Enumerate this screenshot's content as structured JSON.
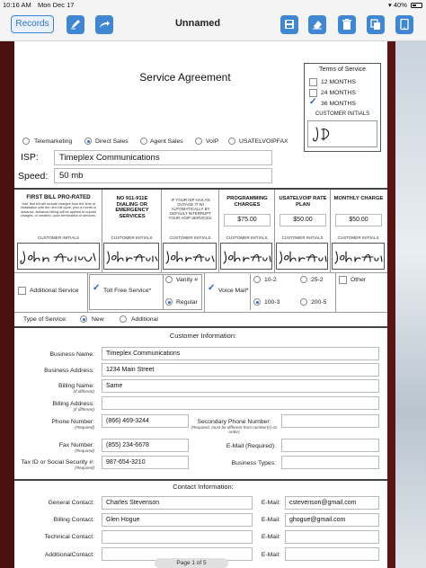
{
  "status_bar": {
    "time": "10:16 AM",
    "date": "Mon Dec 17",
    "battery": "40%"
  },
  "toolbar": {
    "records_label": "Records",
    "title": "Unnamed",
    "icons": [
      "pencil-icon",
      "share-icon",
      "save-icon",
      "eraser-icon",
      "trash-icon",
      "duplicate-icon",
      "tablet-icon"
    ]
  },
  "form": {
    "title": "Service Agreement",
    "term": {
      "label": "Terms of Service",
      "options": [
        "12 MONTHS",
        "24 MONTHS",
        "36 MONTHS"
      ],
      "selected": "36 MONTHS",
      "customer_initials_label": "CUSTOMER INITIALS"
    },
    "sales_types": [
      "Telemarketing",
      "Direct Sales",
      "Agent Sales",
      "VoIP",
      "USATELVOIPFAX"
    ],
    "sales_selected": "Direct Sales",
    "isp": {
      "label": "ISP:",
      "value": "Timeplex Communications"
    },
    "speed": {
      "label": "Speed:",
      "value": "50 mb"
    },
    "columns": [
      {
        "title": "FIRST BILL PRO-RATED",
        "text": "Your first bill will include charges from the time of installation until the next bill cycle, plus a month in advance. Advance billing will be applied to unpaid charges, or credited, upon termination of services.",
        "initials": "CUSTOMER INITIALS"
      },
      {
        "title": "NO 911-911E DIALING OR EMERGENCY SERVICES",
        "text": "",
        "initials": "CUSTOMER INITIALS"
      },
      {
        "title": "",
        "text": "IF YOUR ISP HAS AN OUTAGE IT WI AUTOMATICALLY BY DEFAULT INTERRUPT YOUR VOIP SERVICES.",
        "initials": "CUSTOMER INITIALS"
      },
      {
        "title": "PROGRAMMING CHARGES",
        "amount": "$75.00",
        "initials": "CUSTOMER INITIALS"
      },
      {
        "title": "USATELVOIP RATE PLAN",
        "amount": "$50.00",
        "initials": "CUSTOMER INITIALS"
      },
      {
        "title": "MONTHLY CHARGE",
        "amount": "$50.00",
        "initials": "CUSTOMER INITIALS"
      }
    ],
    "services": {
      "additional_service": "Additional Service",
      "toll_free": "Toll Free Service*",
      "vanity": "Vanity #",
      "regular": "Regular",
      "voice_mail": "Voice Mail*",
      "vm_options": [
        "10-2",
        "25-2",
        "100-3",
        "200-5"
      ],
      "vm_selected": "100-3",
      "other": "Other"
    },
    "type_of_service": {
      "label": "Type of Service:",
      "options": [
        "New",
        "Additional"
      ],
      "selected": "New"
    },
    "customer_info": {
      "title": "Customer Information:",
      "business_name": {
        "label": "Business Name:",
        "value": "Timeplex Communications"
      },
      "business_address": {
        "label": "Business Address:",
        "value": "1234 Main Street"
      },
      "billing_name": {
        "label": "Billing Name:",
        "note": "(If different)",
        "value": "Same"
      },
      "billing_address": {
        "label": "Billing Address:",
        "note": "(If different)",
        "value": ""
      },
      "phone": {
        "label": "Phone Number:",
        "note": "(Required)",
        "value": "(866) 469-3244"
      },
      "secondary_phone": {
        "label": "Secondary Phone Number:",
        "note": "(Required, must be different from number(s) on order)",
        "value": ""
      },
      "fax": {
        "label": "Fax Number:",
        "note": "(Required)",
        "value": "(855) 234-6678"
      },
      "email": {
        "label": "E-Mail (Required):",
        "value": ""
      },
      "tax_id": {
        "label": "Tax ID or Social Security #:",
        "note": "(Required)",
        "value": "987-654-3210"
      },
      "business_types": {
        "label": "Business Types:",
        "value": ""
      }
    },
    "contact_info": {
      "title": "Contact Information:",
      "general": {
        "label": "General Contact:",
        "value": "Charles Stevenson",
        "email_label": "E-Mail:",
        "email": "cstevenson@gmail.com"
      },
      "billing": {
        "label": "Billing Contact:",
        "value": "Glen Hogue",
        "email_label": "E-Mail:",
        "email": "ghogue@gmail.com"
      },
      "technical": {
        "label": "Technical Contact:",
        "value": "",
        "email_label": "E-Mail:",
        "email": ""
      },
      "additional": {
        "label": "AdditionalContact:",
        "value": "",
        "email_label": "E-Mail:",
        "email": ""
      }
    },
    "page_indicator": "Page 1 of 5"
  }
}
